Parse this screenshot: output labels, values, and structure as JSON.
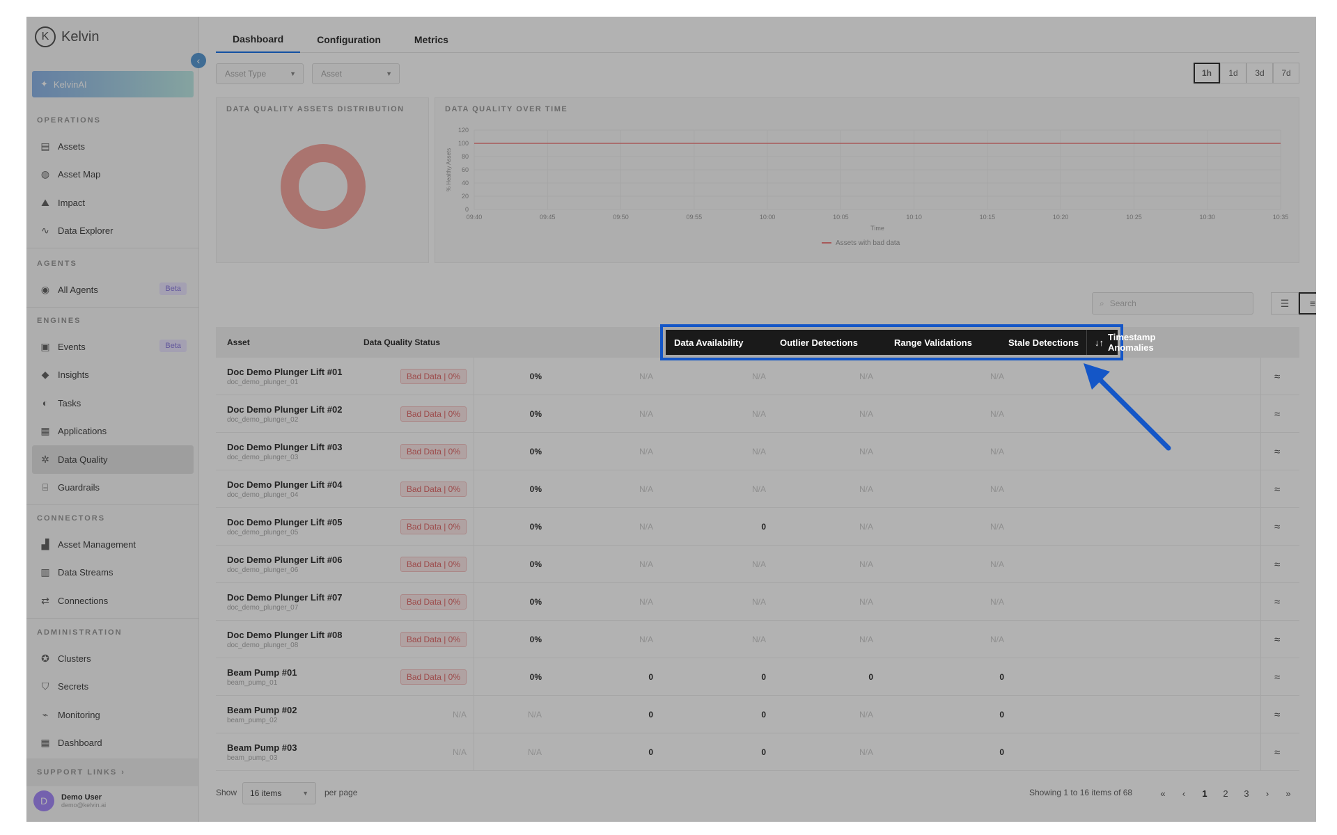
{
  "app": {
    "brand": "Kelvin",
    "ai_label": "KelvinAI",
    "collapse_icon": "chevron-left-icon"
  },
  "sidebar": {
    "sections": [
      {
        "title": "OPERATIONS",
        "items": [
          {
            "label": "Assets",
            "icon": "assets-icon"
          },
          {
            "label": "Asset Map",
            "icon": "globe-icon"
          },
          {
            "label": "Impact",
            "icon": "impact-icon"
          },
          {
            "label": "Data Explorer",
            "icon": "pulse-icon"
          }
        ]
      },
      {
        "title": "AGENTS",
        "items": [
          {
            "label": "All Agents",
            "icon": "agent-icon",
            "badge": "Beta"
          }
        ]
      },
      {
        "title": "ENGINES",
        "items": [
          {
            "label": "Events",
            "icon": "events-icon",
            "badge": "Beta"
          },
          {
            "label": "Insights",
            "icon": "tag-icon"
          },
          {
            "label": "Tasks",
            "icon": "tasks-icon"
          },
          {
            "label": "Applications",
            "icon": "grid-icon"
          },
          {
            "label": "Data Quality",
            "icon": "gear-icon",
            "active": true
          },
          {
            "label": "Guardrails",
            "icon": "guardrail-icon"
          }
        ]
      },
      {
        "title": "CONNECTORS",
        "items": [
          {
            "label": "Asset Management",
            "icon": "asset-mgmt-icon"
          },
          {
            "label": "Data Streams",
            "icon": "chart-icon"
          },
          {
            "label": "Connections",
            "icon": "connection-icon"
          }
        ]
      },
      {
        "title": "ADMINISTRATION",
        "items": [
          {
            "label": "Clusters",
            "icon": "cluster-icon"
          },
          {
            "label": "Secrets",
            "icon": "shield-icon"
          },
          {
            "label": "Monitoring",
            "icon": "monitor-icon"
          },
          {
            "label": "Dashboard",
            "icon": "dashboard-icon"
          }
        ]
      }
    ],
    "support_label": "SUPPORT LINKS",
    "user": {
      "initial": "D",
      "name": "Demo User",
      "email": "demo@kelvin.ai"
    }
  },
  "tabs": [
    {
      "label": "Dashboard",
      "active": true
    },
    {
      "label": "Configuration"
    },
    {
      "label": "Metrics"
    }
  ],
  "filters": {
    "asset_type": "Asset Type",
    "asset": "Asset"
  },
  "time_ranges": [
    "1h",
    "1d",
    "3d",
    "7d"
  ],
  "panels": {
    "distribution_title": "DATA QUALITY ASSETS DISTRIBUTION",
    "over_time_title": "DATA QUALITY OVER TIME"
  },
  "chart_data": {
    "type": "line",
    "title": "DATA QUALITY OVER TIME",
    "xlabel": "Time",
    "ylabel": "% Healthy Assets",
    "x": [
      "09:40",
      "09:45",
      "09:50",
      "09:55",
      "10:00",
      "10:05",
      "10:10",
      "10:15",
      "10:20",
      "10:25",
      "10:30",
      "10:35"
    ],
    "yticks": [
      0,
      20,
      40,
      60,
      80,
      100,
      120
    ],
    "ylim": [
      0,
      120
    ],
    "series": [
      {
        "name": "Assets with bad data",
        "values": [
          100,
          100,
          100,
          100,
          100,
          100,
          100,
          100,
          100,
          100,
          100,
          100
        ],
        "color": "#f08080"
      }
    ],
    "legend": "bottom",
    "grid": true
  },
  "donut": {
    "color": "#f4a6a0"
  },
  "search": {
    "placeholder": "Search"
  },
  "table": {
    "headers": {
      "asset": "Asset",
      "status": "Data Quality Status",
      "availability": "Data Availability",
      "outlier": "Outlier Detections",
      "range": "Range Validations",
      "stale": "Stale Detections",
      "timestamp": "Timestamp Anomalies",
      "sort_icon": "sort-icon"
    },
    "rows": [
      {
        "name": "Doc Demo Plunger Lift #01",
        "id": "doc_demo_plunger_01",
        "status": "Bad Data | 0%",
        "availability": "0%",
        "outlier": "N/A",
        "range": "N/A",
        "stale": "N/A",
        "timestamp": "N/A"
      },
      {
        "name": "Doc Demo Plunger Lift #02",
        "id": "doc_demo_plunger_02",
        "status": "Bad Data | 0%",
        "availability": "0%",
        "outlier": "N/A",
        "range": "N/A",
        "stale": "N/A",
        "timestamp": "N/A"
      },
      {
        "name": "Doc Demo Plunger Lift #03",
        "id": "doc_demo_plunger_03",
        "status": "Bad Data | 0%",
        "availability": "0%",
        "outlier": "N/A",
        "range": "N/A",
        "stale": "N/A",
        "timestamp": "N/A"
      },
      {
        "name": "Doc Demo Plunger Lift #04",
        "id": "doc_demo_plunger_04",
        "status": "Bad Data | 0%",
        "availability": "0%",
        "outlier": "N/A",
        "range": "N/A",
        "stale": "N/A",
        "timestamp": "N/A"
      },
      {
        "name": "Doc Demo Plunger Lift #05",
        "id": "doc_demo_plunger_05",
        "status": "Bad Data | 0%",
        "availability": "0%",
        "outlier": "N/A",
        "range": "0",
        "stale": "N/A",
        "timestamp": "N/A"
      },
      {
        "name": "Doc Demo Plunger Lift #06",
        "id": "doc_demo_plunger_06",
        "status": "Bad Data | 0%",
        "availability": "0%",
        "outlier": "N/A",
        "range": "N/A",
        "stale": "N/A",
        "timestamp": "N/A"
      },
      {
        "name": "Doc Demo Plunger Lift #07",
        "id": "doc_demo_plunger_07",
        "status": "Bad Data | 0%",
        "availability": "0%",
        "outlier": "N/A",
        "range": "N/A",
        "stale": "N/A",
        "timestamp": "N/A"
      },
      {
        "name": "Doc Demo Plunger Lift #08",
        "id": "doc_demo_plunger_08",
        "status": "Bad Data | 0%",
        "availability": "0%",
        "outlier": "N/A",
        "range": "N/A",
        "stale": "N/A",
        "timestamp": "N/A"
      },
      {
        "name": "Beam Pump #01",
        "id": "beam_pump_01",
        "status": "Bad Data | 0%",
        "availability": "0%",
        "outlier": "0",
        "range": "0",
        "stale": "0",
        "timestamp": "0"
      },
      {
        "name": "Beam Pump #02",
        "id": "beam_pump_02",
        "status": "N/A",
        "availability": "N/A",
        "outlier": "0",
        "range": "0",
        "stale": "N/A",
        "timestamp": "0"
      },
      {
        "name": "Beam Pump #03",
        "id": "beam_pump_03",
        "status": "N/A",
        "availability": "N/A",
        "outlier": "0",
        "range": "0",
        "stale": "N/A",
        "timestamp": "0"
      }
    ],
    "row_action_icon": "trend-icon"
  },
  "pagination": {
    "show": "Show",
    "per_page_value": "16 items",
    "per_page": "per page",
    "summary": "Showing 1 to 16 items of 68",
    "pages": [
      "1",
      "2",
      "3"
    ],
    "first": "«",
    "prev": "‹",
    "next": "›",
    "last": "»"
  },
  "annotation": {
    "color": "#1456c7"
  }
}
